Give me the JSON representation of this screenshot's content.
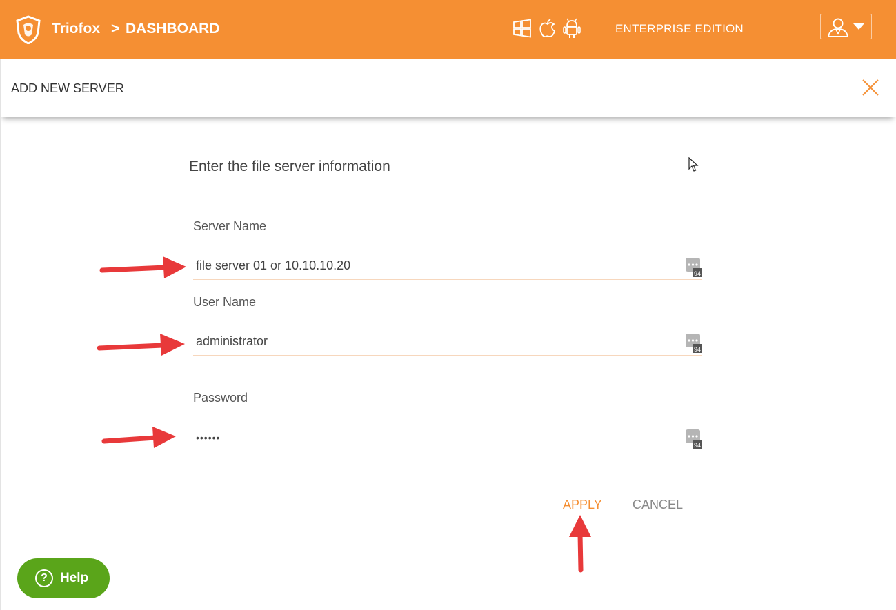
{
  "header": {
    "brand": "Triofox",
    "breadcrumb_sep": ">",
    "breadcrumb": "DASHBOARD",
    "platform_icons": [
      "windows-icon",
      "apple-icon",
      "android-icon"
    ],
    "edition": "ENTERPRISE EDITION",
    "user_menu_icon": "user-icon",
    "accent_color": "#f58f33"
  },
  "panel": {
    "title": "ADD NEW SERVER",
    "close_icon": "close-icon",
    "section_title": "Enter the file server information",
    "fields": [
      {
        "label": "Server Name",
        "value": "file server 01 or 10.10.10.20"
      },
      {
        "label": "User Name",
        "value": "administrator"
      },
      {
        "label": "Password",
        "value": "••••••"
      }
    ],
    "apply_label": "APPLY",
    "cancel_label": "CANCEL"
  },
  "help": {
    "label": "Help",
    "icon": "?",
    "color": "#5aa51a"
  },
  "annotation_color": "#e8393a"
}
